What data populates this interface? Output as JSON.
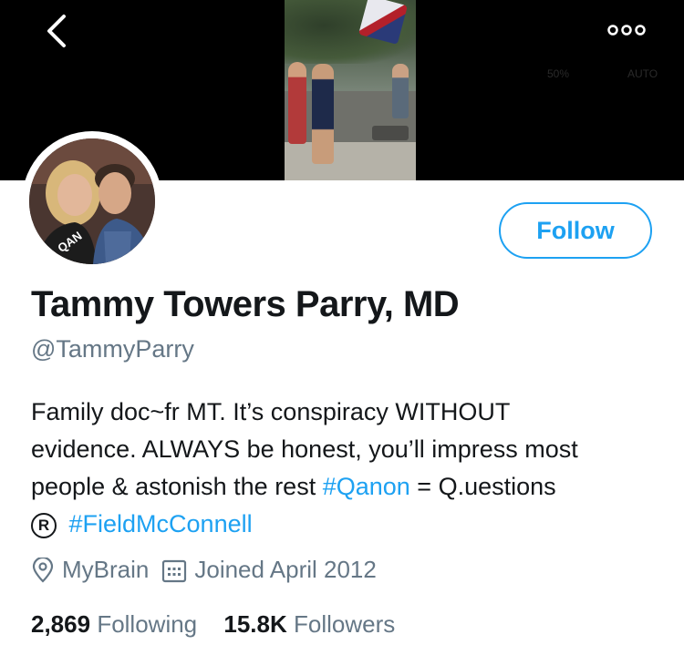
{
  "header": {
    "back_icon": "chevron-left-icon",
    "more_icon": "more-horizontal-icon",
    "faint_labels": [
      "50%",
      "AUTO"
    ]
  },
  "profile": {
    "display_name": "Tammy Towers Parry, MD",
    "handle": "@TammyParry",
    "follow_label": "Follow",
    "avatar_text": "QAN",
    "bio": {
      "line1": "Family doc~fr MT. It’s conspiracy WITHOUT",
      "line2": "evidence. ALWAYS be honest, you’ll impress most",
      "line3_text": "people & astonish the rest ",
      "line3_hashtag": "#Qanon",
      "line3_after": " = Q.uestions",
      "line4_symbol": "R",
      "line4_hashtag": "#FieldMcConnell"
    },
    "location": "MyBrain",
    "joined": "Joined April 2012",
    "following_count": "2,869",
    "following_label": "Following",
    "followers_count": "15.8K",
    "followers_label": "Followers"
  },
  "colors": {
    "accent": "#1da1f2",
    "muted": "#657786",
    "text": "#14171a"
  }
}
